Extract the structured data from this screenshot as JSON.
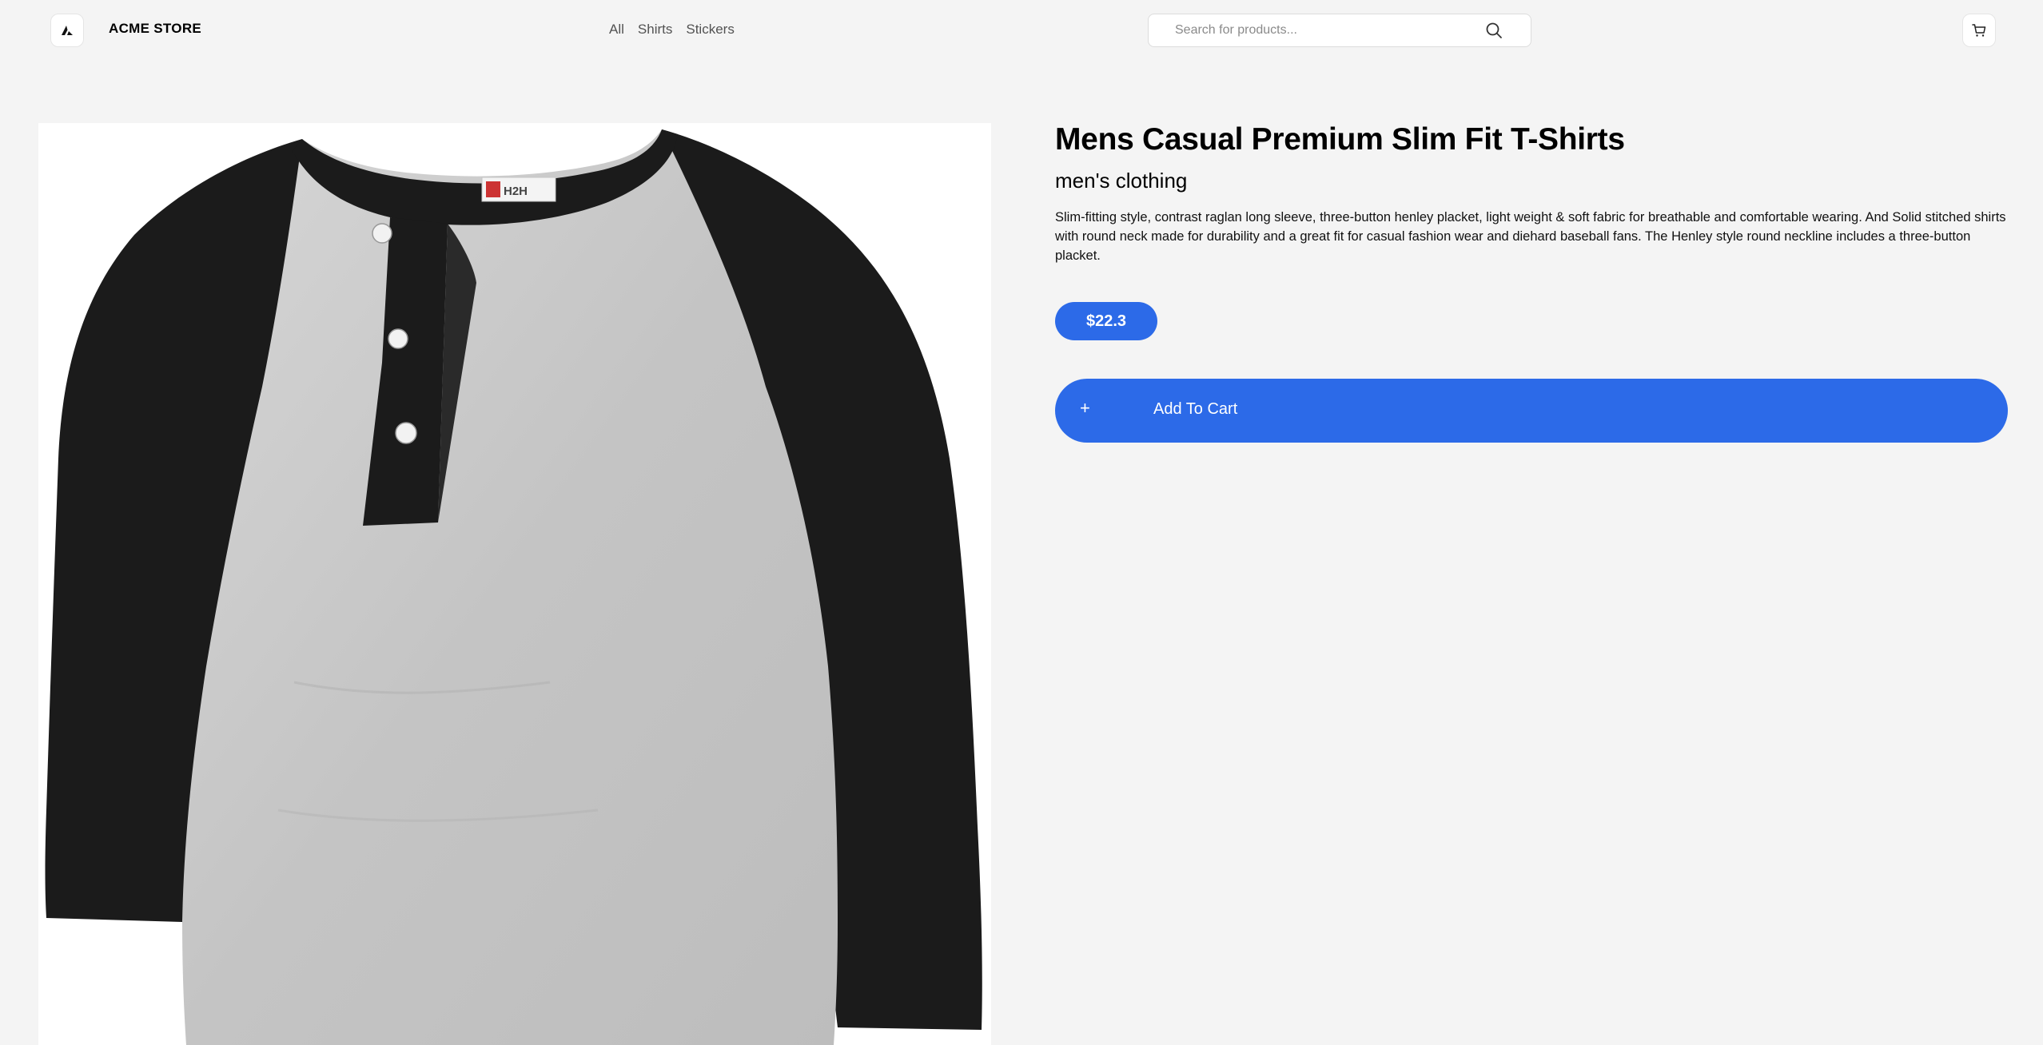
{
  "header": {
    "store_name": "ACME STORE",
    "logo_icon": "triangle-logo-icon",
    "nav": [
      {
        "label": "All"
      },
      {
        "label": "Shirts"
      },
      {
        "label": "Stickers"
      }
    ],
    "search": {
      "placeholder": "Search for products...",
      "value": "",
      "icon": "search-icon"
    },
    "cart_icon": "cart-icon"
  },
  "product": {
    "title": "Mens Casual Premium Slim Fit T-Shirts",
    "category": "men's clothing",
    "description": "Slim-fitting style, contrast raglan long sleeve, three-button henley placket, light weight & soft fabric for breathable and comfortable wearing. And Solid stitched shirts with round neck made for durability and a great fit for casual fashion wear and diehard baseball fans. The Henley style round neckline includes a three-button placket.",
    "price": "$22.3",
    "tag_text": "H2H",
    "add_to_cart": {
      "icon": "+",
      "label": "Add To Cart"
    }
  },
  "colors": {
    "accent": "#2c6ae8",
    "background": "#f4f4f4",
    "shirt_body": "#c9c9c9",
    "shirt_sleeves": "#1a1a1a"
  }
}
